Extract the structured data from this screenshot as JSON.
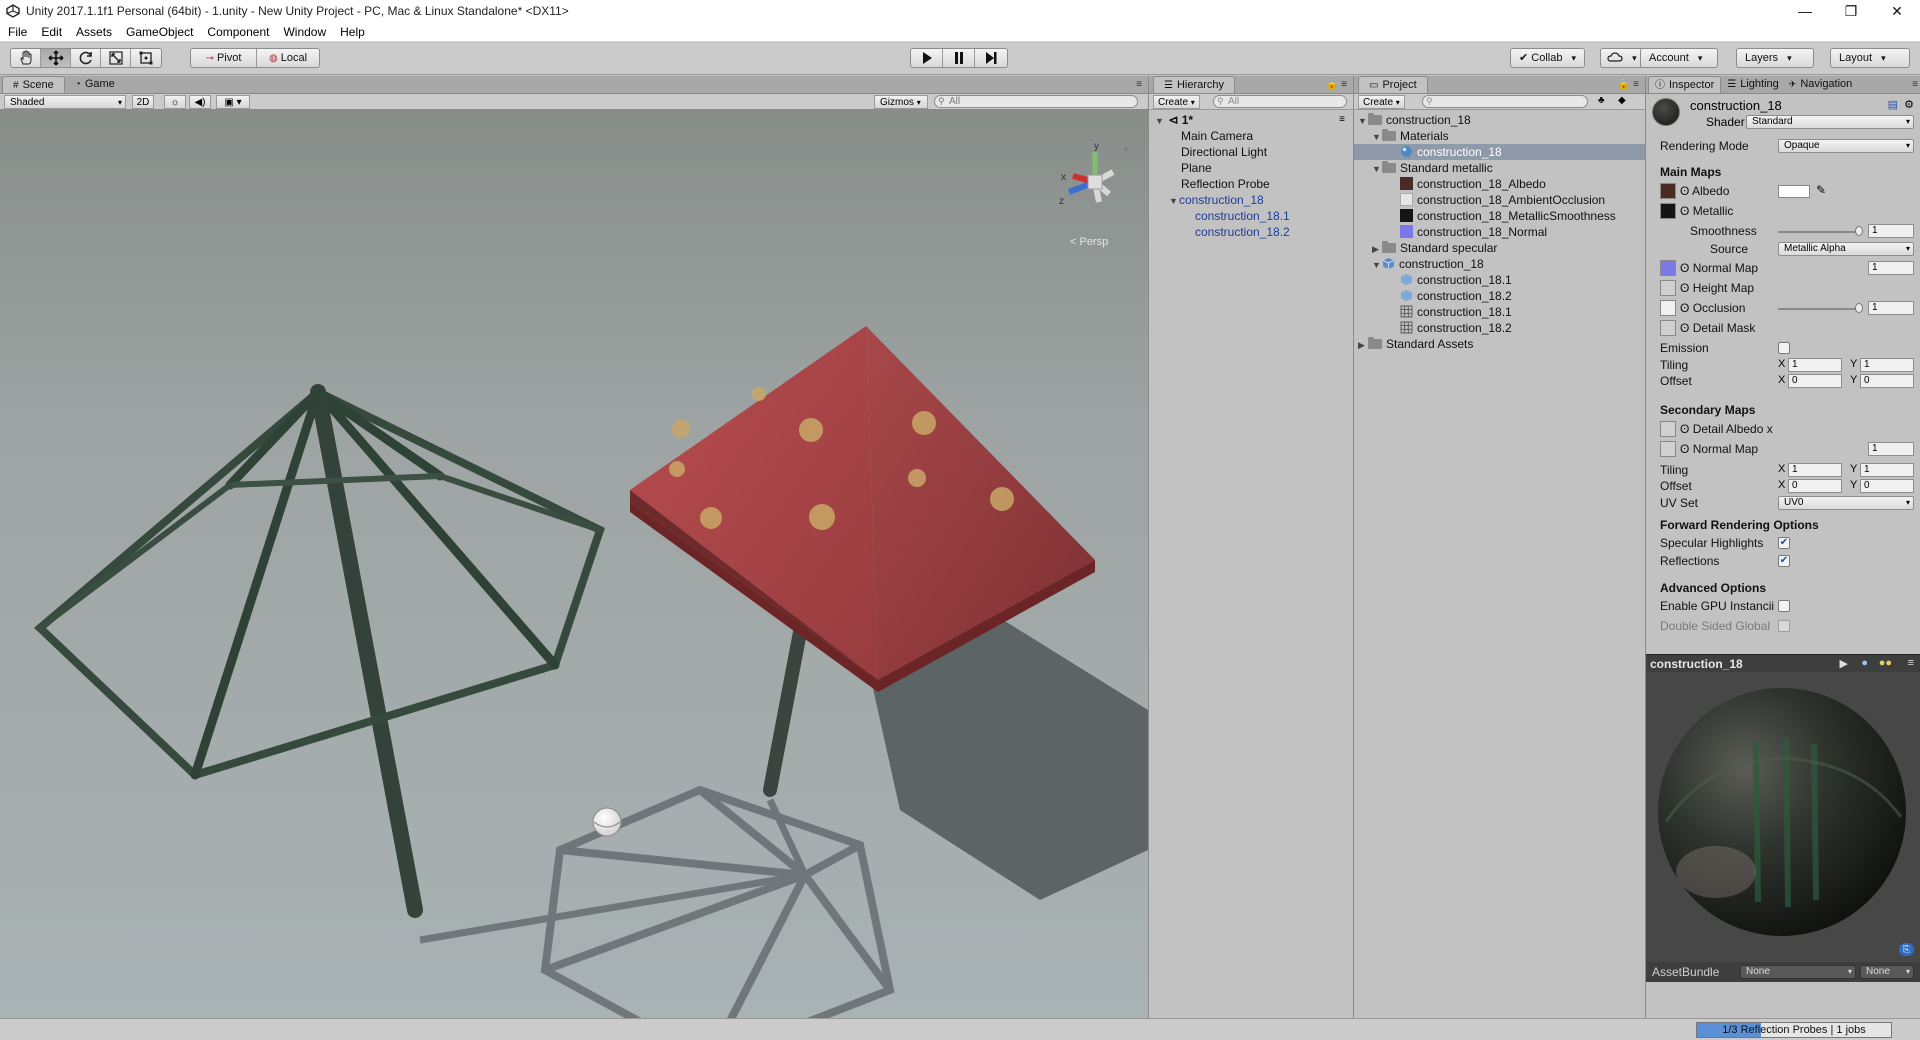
{
  "window": {
    "title": "Unity 2017.1.1f1 Personal (64bit) - 1.unity - New Unity Project - PC, Mac & Linux Standalone* <DX11>",
    "controls": [
      "—",
      "❐",
      "✕"
    ]
  },
  "menu": [
    "File",
    "Edit",
    "Assets",
    "GameObject",
    "Component",
    "Window",
    "Help"
  ],
  "toolbar": {
    "pivot": "Pivot",
    "local": "Local",
    "collab": "Collab",
    "account": "Account",
    "layers": "Layers",
    "layout": "Layout"
  },
  "scene": {
    "tabs": [
      "Scene",
      "Game"
    ],
    "shading": "Shaded",
    "mode_2d": "2D",
    "gizmos": "Gizmos",
    "search_placeholder": "All",
    "persp": "< Persp",
    "axis_y": "y",
    "axis_x": "x",
    "axis_z": "z"
  },
  "hierarchy": {
    "tab": "Hierarchy",
    "create": "Create",
    "search_placeholder": "All",
    "scene_name": "1*",
    "items": [
      {
        "label": "Main Camera",
        "level": 1,
        "blue": false
      },
      {
        "label": "Directional Light",
        "level": 1,
        "blue": false
      },
      {
        "label": "Plane",
        "level": 1,
        "blue": false
      },
      {
        "label": "Reflection Probe",
        "level": 1,
        "blue": false
      },
      {
        "label": "construction_18",
        "level": 1,
        "blue": true
      },
      {
        "label": "construction_18.1",
        "level": 2,
        "blue": true
      },
      {
        "label": "construction_18.2",
        "level": 2,
        "blue": true
      }
    ]
  },
  "project": {
    "tab": "Project",
    "create": "Create",
    "items": [
      {
        "label": "construction_18",
        "level": 0,
        "type": "folder"
      },
      {
        "label": "Materials",
        "level": 1,
        "type": "folder"
      },
      {
        "label": "construction_18",
        "level": 2,
        "type": "material"
      },
      {
        "label": "Standard metallic",
        "level": 1,
        "type": "folder"
      },
      {
        "label": "construction_18_Albedo",
        "level": 2,
        "type": "tex-albedo"
      },
      {
        "label": "construction_18_AmbientOcclusion",
        "level": 2,
        "type": "tex-ao"
      },
      {
        "label": "construction_18_MetallicSmoothness",
        "level": 2,
        "type": "tex-metal"
      },
      {
        "label": "construction_18_Normal",
        "level": 2,
        "type": "tex-normal"
      },
      {
        "label": "Standard specular",
        "level": 1,
        "type": "folder"
      },
      {
        "label": "construction_18",
        "level": 1,
        "type": "prefab"
      },
      {
        "label": "construction_18.1",
        "level": 2,
        "type": "mesh"
      },
      {
        "label": "construction_18.2",
        "level": 2,
        "type": "mesh"
      },
      {
        "label": "construction_18.1",
        "level": 2,
        "type": "grid"
      },
      {
        "label": "construction_18.2",
        "level": 2,
        "type": "grid"
      },
      {
        "label": "Standard Assets",
        "level": 0,
        "type": "folder"
      }
    ]
  },
  "inspector": {
    "tabs": [
      "Inspector",
      "Lighting",
      "Navigation"
    ],
    "object_name": "construction_18",
    "shader_label": "Shader",
    "shader_value": "Standard",
    "rendering_mode_label": "Rendering Mode",
    "rendering_mode_value": "Opaque",
    "main_maps": "Main Maps",
    "albedo": "Albedo",
    "metallic": "Metallic",
    "smoothness": "Smoothness",
    "smoothness_value": "1",
    "source": "Source",
    "source_value": "Metallic Alpha",
    "normal_map": "Normal Map",
    "normal_map_value": "1",
    "height_map": "Height Map",
    "occlusion": "Occlusion",
    "occlusion_value": "1",
    "detail_mask": "Detail Mask",
    "emission": "Emission",
    "tiling": "Tiling",
    "offset": "Offset",
    "x": "X",
    "y": "Y",
    "tiling_x": "1",
    "tiling_y": "1",
    "offset_x": "0",
    "offset_y": "0",
    "secondary_maps": "Secondary Maps",
    "detail_albedo": "Detail Albedo x",
    "normal_map2": "Normal Map",
    "normal_map2_value": "1",
    "tiling2_x": "1",
    "tiling2_y": "1",
    "offset2_x": "0",
    "offset2_y": "0",
    "uv_set": "UV Set",
    "uv_set_value": "UV0",
    "forward_options": "Forward Rendering Options",
    "specular_highlights": "Specular Highlights",
    "reflections": "Reflections",
    "advanced_options": "Advanced Options",
    "gpu_instancing": "Enable GPU Instancii",
    "double_sided": "Double Sided Global",
    "preview_title": "construction_18",
    "asset_bundle": "AssetBundle",
    "asset_bundle_value": "None",
    "asset_bundle_variant": "None"
  },
  "status": {
    "progress_text": "1/3 Reflection Probes | 1 jobs",
    "progress": 0.33
  }
}
